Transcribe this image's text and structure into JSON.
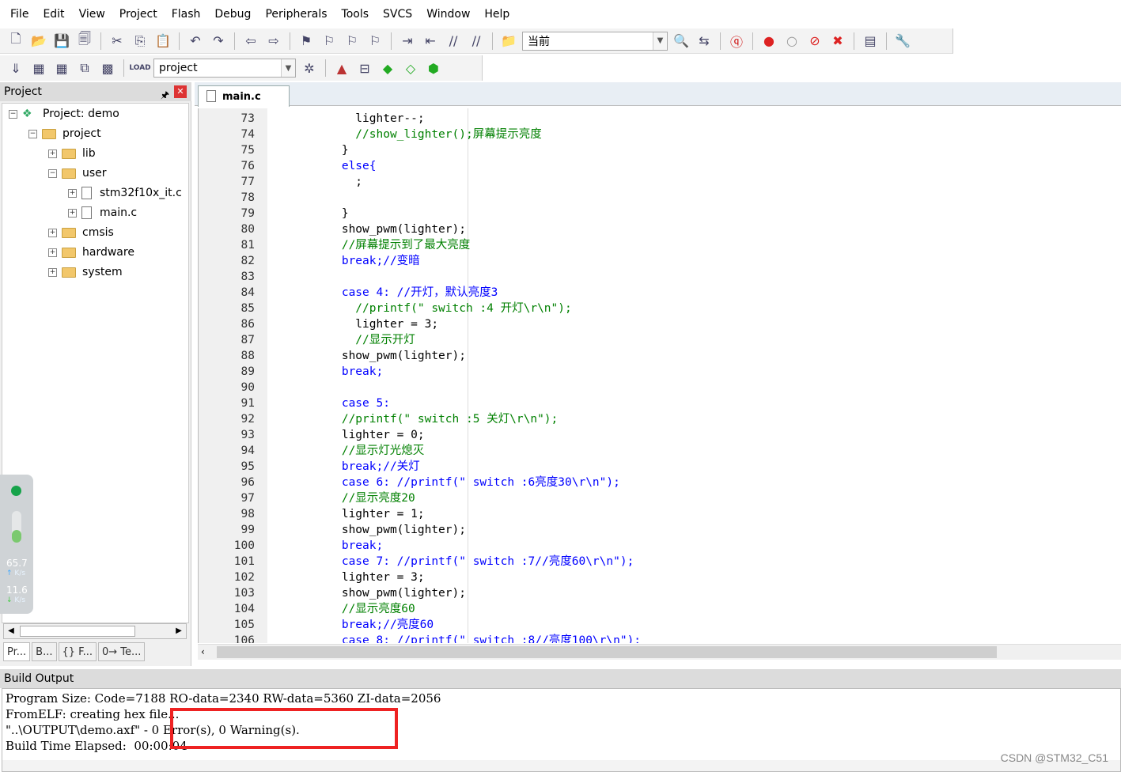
{
  "menu": [
    "File",
    "Edit",
    "View",
    "Project",
    "Flash",
    "Debug",
    "Peripherals",
    "Tools",
    "SVCS",
    "Window",
    "Help"
  ],
  "toolbar": {
    "find_combo": "当前"
  },
  "toolbar2": {
    "target_combo": "project",
    "load_label": "LOAD"
  },
  "project_panel": {
    "title": "Project",
    "tree": [
      {
        "label": "Project: demo",
        "indent": 0
      },
      {
        "label": "project",
        "indent": 1
      },
      {
        "label": "lib",
        "indent": 2
      },
      {
        "label": "user",
        "indent": 2
      },
      {
        "label": "stm32f10x_it.c",
        "indent": 3
      },
      {
        "label": "main.c",
        "indent": 3
      },
      {
        "label": "cmsis",
        "indent": 2
      },
      {
        "label": "hardware",
        "indent": 2
      },
      {
        "label": "system",
        "indent": 2
      }
    ],
    "tabs": [
      "Pr...",
      "B...",
      "{} F...",
      "0→ Te..."
    ]
  },
  "net_widget": {
    "up": "65.7",
    "up_unit": "K/s",
    "down": "11.6",
    "down_unit": "K/s"
  },
  "editor": {
    "tab": "main.c",
    "lines": [
      {
        "n": "73",
        "t": "          lighter--;",
        "c": "nm"
      },
      {
        "n": "74",
        "t": "          //show_lighter();屏幕提示亮度",
        "c": "cm"
      },
      {
        "n": "75",
        "t": "        }",
        "c": "nm"
      },
      {
        "n": "76",
        "t": "        else{",
        "c": "kw"
      },
      {
        "n": "77",
        "t": "          ;",
        "c": "nm"
      },
      {
        "n": "78",
        "t": "",
        "c": "nm"
      },
      {
        "n": "79",
        "t": "        }",
        "c": "nm"
      },
      {
        "n": "80",
        "t": "        show_pwm(lighter);",
        "c": "nm"
      },
      {
        "n": "81",
        "t": "        //屏幕提示到了最大亮度",
        "c": "cm"
      },
      {
        "n": "82",
        "t": "        break;//变暗",
        "c": "kw"
      },
      {
        "n": "83",
        "t": "",
        "c": "nm"
      },
      {
        "n": "84",
        "t": "        case 4: //开灯，默认亮度3",
        "c": "kw"
      },
      {
        "n": "85",
        "t": "          //printf(\" switch :4 开灯\\r\\n\");",
        "c": "cm"
      },
      {
        "n": "86",
        "t": "          lighter = 3;",
        "c": "nm"
      },
      {
        "n": "87",
        "t": "          //显示开灯",
        "c": "cm"
      },
      {
        "n": "88",
        "t": "        show_pwm(lighter);",
        "c": "nm"
      },
      {
        "n": "89",
        "t": "        break;",
        "c": "kw"
      },
      {
        "n": "90",
        "t": "",
        "c": "nm"
      },
      {
        "n": "91",
        "t": "        case 5:",
        "c": "kw"
      },
      {
        "n": "92",
        "t": "        //printf(\" switch :5 关灯\\r\\n\");",
        "c": "cm"
      },
      {
        "n": "93",
        "t": "        lighter = 0;",
        "c": "nm"
      },
      {
        "n": "94",
        "t": "        //显示灯光熄灭",
        "c": "cm"
      },
      {
        "n": "95",
        "t": "        break;//关灯",
        "c": "kw"
      },
      {
        "n": "96",
        "t": "        case 6: //printf(\" switch :6亮度30\\r\\n\");",
        "c": "kw"
      },
      {
        "n": "97",
        "t": "        //显示亮度20",
        "c": "cm"
      },
      {
        "n": "98",
        "t": "        lighter = 1;",
        "c": "nm"
      },
      {
        "n": "99",
        "t": "        show_pwm(lighter);",
        "c": "nm"
      },
      {
        "n": "100",
        "t": "        break;",
        "c": "kw"
      },
      {
        "n": "101",
        "t": "        case 7: //printf(\" switch :7//亮度60\\r\\n\");",
        "c": "kw"
      },
      {
        "n": "102",
        "t": "        lighter = 3;",
        "c": "nm"
      },
      {
        "n": "103",
        "t": "        show_pwm(lighter);",
        "c": "nm"
      },
      {
        "n": "104",
        "t": "        //显示亮度60",
        "c": "cm"
      },
      {
        "n": "105",
        "t": "        break;//亮度60",
        "c": "kw"
      },
      {
        "n": "106",
        "t": "        case 8: //printf(\" switch :8//亮度100\\r\\n\");",
        "c": "kw"
      }
    ]
  },
  "build_output": {
    "title": "Build Output",
    "lines": [
      "Program Size: Code=7188 RO-data=2340 RW-data=5360 ZI-data=2056",
      "FromELF: creating hex file...",
      "\"..\\OUTPUT\\demo.axf\" - 0 Error(s), 0 Warning(s).",
      "Build Time Elapsed:  00:00:04"
    ]
  },
  "watermark": "CSDN @STM32_C51"
}
